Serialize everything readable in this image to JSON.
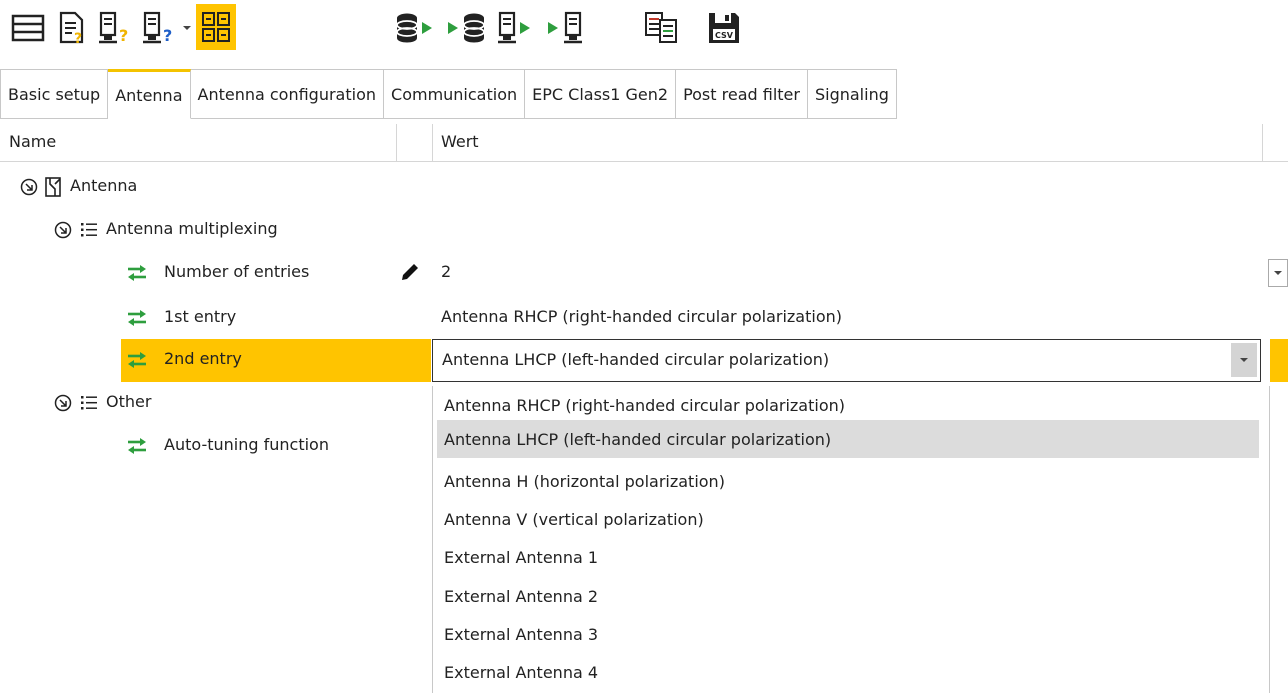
{
  "toolbar": {
    "icons": [
      "list-view-icon",
      "document-help-icon",
      "device-help-icon",
      "device-key-icon",
      "dropdown-arrow-icon",
      "grid-view-icon",
      "database-export-icon",
      "database-import-icon",
      "device-export-icon",
      "device-import-icon",
      "compare-icon",
      "save-csv-icon"
    ],
    "csv_label": "CSV",
    "accent": "#f4c300"
  },
  "tabs": [
    {
      "label": "Basic setup",
      "active": false
    },
    {
      "label": "Antenna",
      "active": true
    },
    {
      "label": "Antenna configuration",
      "active": false
    },
    {
      "label": "Communication",
      "active": false
    },
    {
      "label": "EPC Class1 Gen2",
      "active": false
    },
    {
      "label": "Post read filter",
      "active": false
    },
    {
      "label": "Signaling",
      "active": false
    }
  ],
  "grid": {
    "col_name": "Name",
    "col_value": "Wert"
  },
  "tree": {
    "antenna": "Antenna",
    "multiplexing": "Antenna multiplexing",
    "num_entries_label": "Number of entries",
    "num_entries_value": "2",
    "first_entry_label": "1st entry",
    "first_entry_value": "Antenna RHCP (right-handed circular polarization)",
    "second_entry_label": "2nd entry",
    "second_entry_value": "Antenna LHCP (left-handed circular polarization)",
    "other": "Other",
    "auto_tuning": "Auto-tuning function"
  },
  "dropdown": {
    "options": [
      "Antenna RHCP (right-handed circular polarization)",
      "Antenna LHCP (left-handed circular polarization)",
      "Antenna H (horizontal polarization)",
      "Antenna V (vertical polarization)",
      "External Antenna 1",
      "External Antenna 2",
      "External Antenna 3",
      "External Antenna 4"
    ],
    "highlighted": "Antenna LHCP (left-handed circular polarization)"
  },
  "colors": {
    "selection": "#ffc400",
    "arrows": "#2e9e3e",
    "highlight": "#dcdcdc"
  }
}
